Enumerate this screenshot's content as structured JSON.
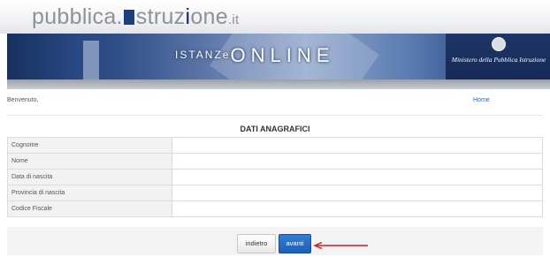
{
  "header": {
    "logo_prefix": "pubblica.",
    "logo_i": "i",
    "logo_str": "struz",
    "logo_i2": "i",
    "logo_one": "one",
    "logo_tld": ".it",
    "banner_title_a": "ISTANZ",
    "banner_title_b": "e",
    "banner_title_c": "ON",
    "banner_title_d": "LINE",
    "ministry_text": "Ministero della Pubblica Istruzione"
  },
  "welcome": {
    "greeting": "Benvenuto,",
    "home_link": "Home"
  },
  "form": {
    "title": "DATI ANAGRAFICI",
    "fields": [
      {
        "label": "Cognome",
        "value": ""
      },
      {
        "label": "Nome",
        "value": ""
      },
      {
        "label": "Data di nascita",
        "value": ""
      },
      {
        "label": "Provincia di nascita",
        "value": ""
      },
      {
        "label": "Codice Fiscale",
        "value": ""
      }
    ]
  },
  "buttons": {
    "back": "indietro",
    "next": "avanti"
  },
  "colors": {
    "primary_button": "#1c5fb8",
    "link": "#2a66b8",
    "arrow": "#d11e1e"
  }
}
